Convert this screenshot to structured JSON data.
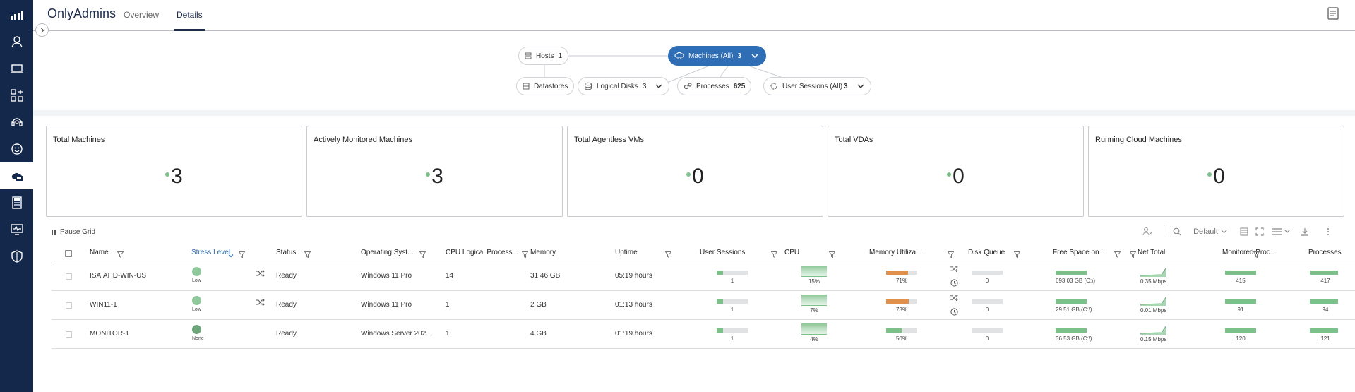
{
  "app": {
    "title": "OnlyAdmins"
  },
  "tabs": [
    {
      "label": "Overview"
    },
    {
      "label": "Details"
    }
  ],
  "nav": [
    "chart-bars-icon",
    "user-icon",
    "laptop-icon",
    "apps-icon",
    "headset-icon",
    "smiley-icon",
    "cloud-folders-icon",
    "calculator-icon",
    "monitor-pulse-icon",
    "shield-icon"
  ],
  "topology": {
    "hosts": {
      "label": "Hosts",
      "count": "1"
    },
    "machines": {
      "label": "Machines (All)",
      "count": "3"
    },
    "datastores": {
      "label": "Datastores"
    },
    "logical_disks": {
      "label": "Logical Disks",
      "count": "3"
    },
    "processes": {
      "label": "Processes",
      "count": "625"
    },
    "user_sessions": {
      "label": "User Sessions (All)",
      "count": "3"
    }
  },
  "cards": [
    {
      "title": "Total Machines",
      "value": "3"
    },
    {
      "title": "Actively Monitored Machines",
      "value": "3"
    },
    {
      "title": "Total Agentless VMs",
      "value": "0"
    },
    {
      "title": "Total VDAs",
      "value": "0"
    },
    {
      "title": "Running Cloud Machines",
      "value": "0"
    }
  ],
  "toolbar": {
    "pause_label": "Pause Grid",
    "view_label": "Default"
  },
  "columns": [
    "Name",
    "Stress Level",
    "Status",
    "Operating Syst...",
    "CPU Logical Process...",
    "Memory",
    "Uptime",
    "User Sessions",
    "CPU",
    "Memory Utiliza...",
    "Disk Queue",
    "Free Space on ...",
    "Net Total",
    "Monitored Proc...",
    "Processes"
  ],
  "rows": [
    {
      "name": "ISAIAHD-WIN-US",
      "stress": "Low",
      "stress_color": "#8fc99b",
      "status": "Ready",
      "os": "Windows 11 Pro",
      "cpu_logical": "14",
      "memory": "31.46 GB",
      "uptime": "05:19 hours",
      "user_sessions": "1",
      "user_sessions_frac": 0.2,
      "cpu": "15%",
      "cpu_frac": 0.15,
      "mem_util": "71%",
      "mem_frac": 0.71,
      "mem_color": "#e0904a",
      "disk_queue": "0",
      "free_space": "693.03 GB (C:\\)",
      "net_total": "0.35 Mbps",
      "monitored_proc": "415",
      "processes": "417",
      "has_icons": true
    },
    {
      "name": "WIN11-1",
      "stress": "Low",
      "stress_color": "#8fc99b",
      "status": "Ready",
      "os": "Windows 11 Pro",
      "cpu_logical": "1",
      "memory": "2 GB",
      "uptime": "01:13 hours",
      "user_sessions": "1",
      "user_sessions_frac": 0.2,
      "cpu": "7%",
      "cpu_frac": 0.07,
      "mem_util": "73%",
      "mem_frac": 0.73,
      "mem_color": "#e0904a",
      "disk_queue": "0",
      "free_space": "29.51 GB (C:\\)",
      "net_total": "0.01 Mbps",
      "monitored_proc": "91",
      "processes": "94",
      "has_icons": true
    },
    {
      "name": "MONITOR-1",
      "stress": "None",
      "stress_color": "#6da67b",
      "status": "Ready",
      "os": "Windows Server 202...",
      "cpu_logical": "1",
      "memory": "4 GB",
      "uptime": "01:19 hours",
      "user_sessions": "1",
      "user_sessions_frac": 0.2,
      "cpu": "4%",
      "cpu_frac": 0.04,
      "mem_util": "50%",
      "mem_frac": 0.5,
      "mem_color": "#7cc18a",
      "disk_queue": "0",
      "free_space": "36.53 GB (C:\\)",
      "net_total": "0.15 Mbps",
      "monitored_proc": "120",
      "processes": "121",
      "has_icons": false
    }
  ],
  "colors": {
    "rail": "#14284b",
    "accent": "#2f6eb5",
    "green": "#7cc18a",
    "orange": "#e0904a"
  }
}
